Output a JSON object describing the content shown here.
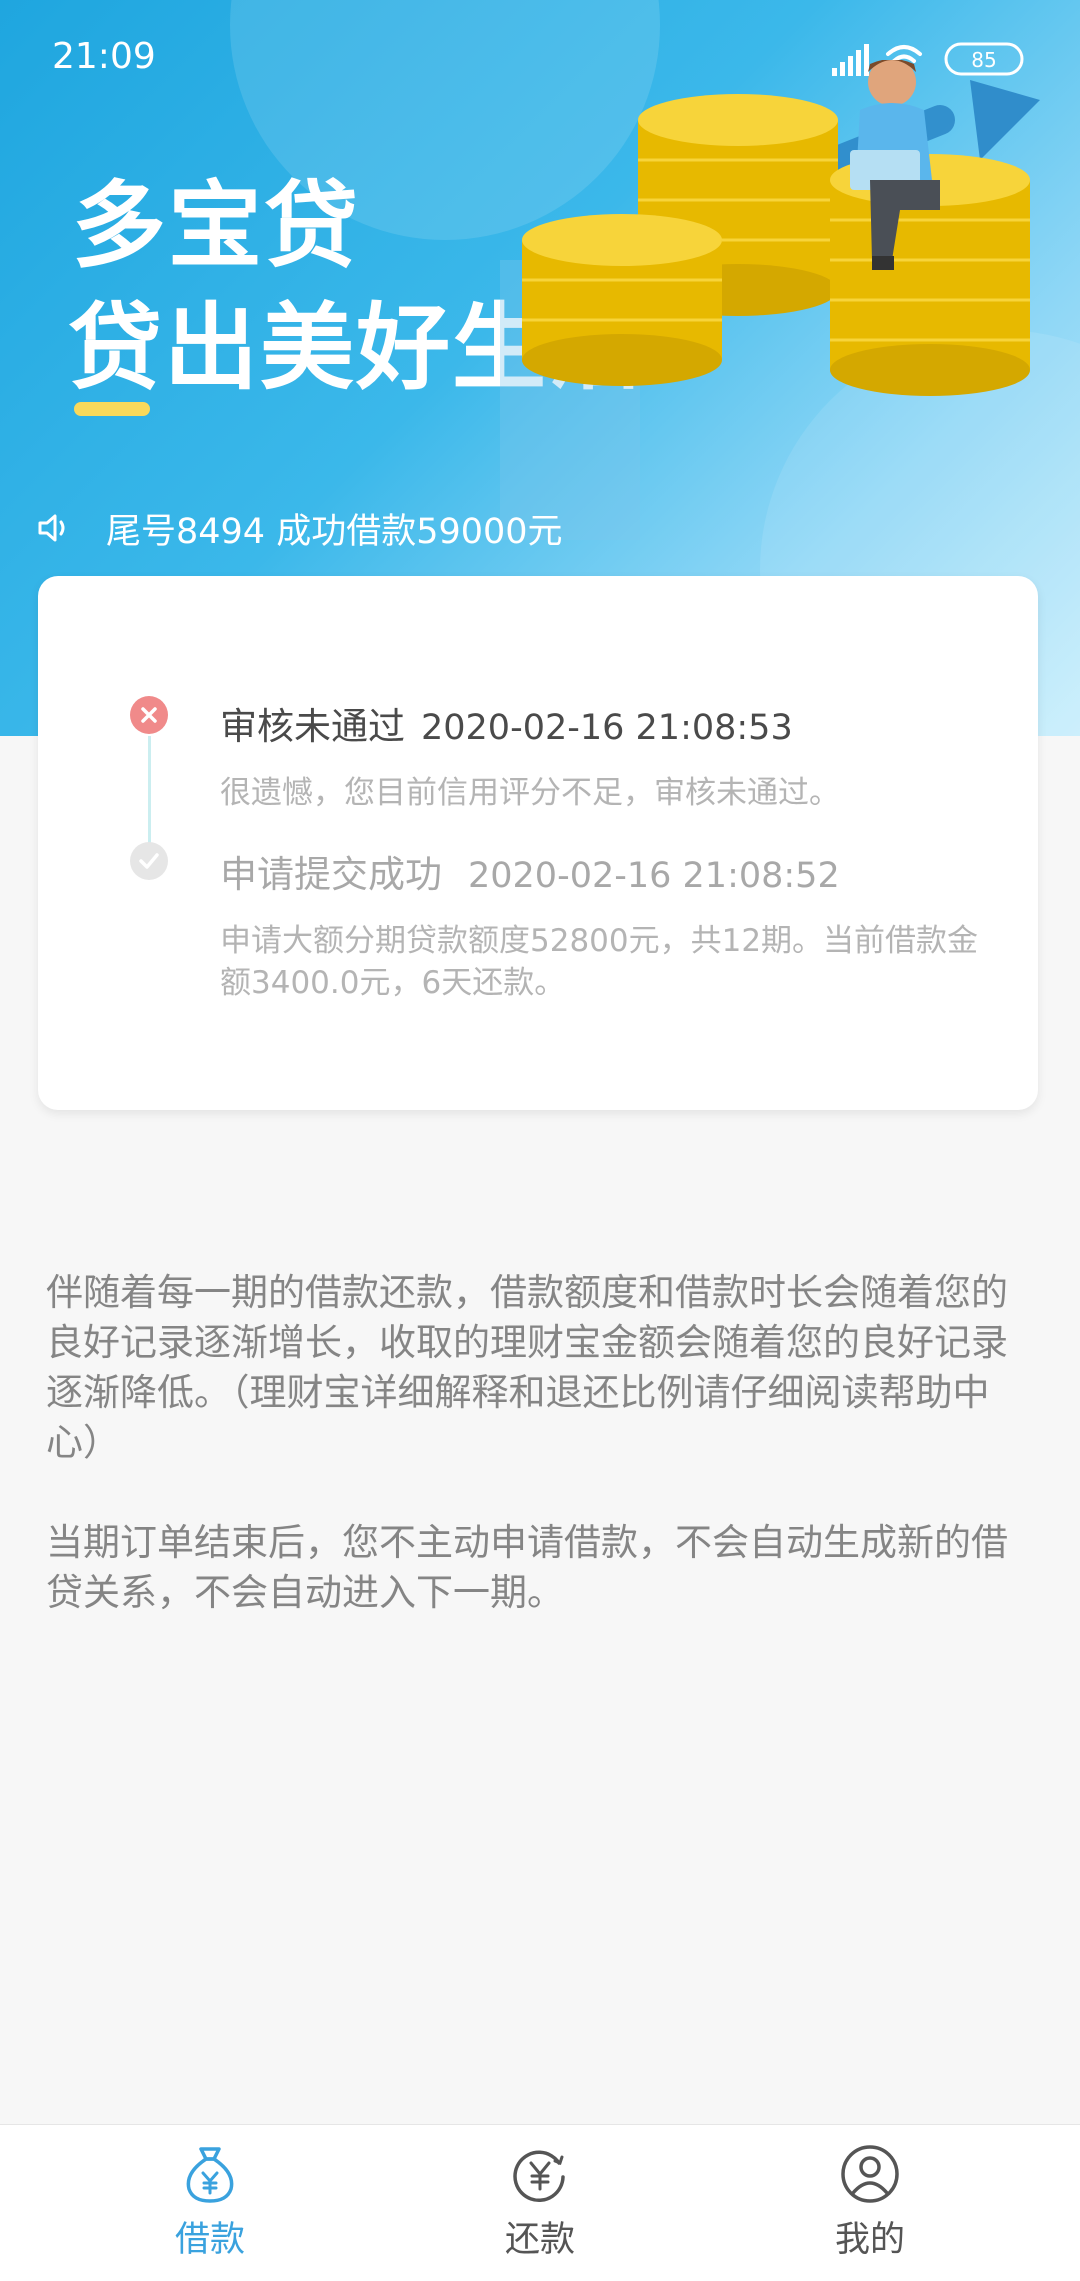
{
  "status_bar": {
    "time": "21:09",
    "battery": "85"
  },
  "banner": {
    "brand": "多宝贷",
    "slogan": "贷出美好生活",
    "notice": "尾号8494 成功借款59000元"
  },
  "timeline": [
    {
      "title": "审核未通过",
      "time": "2020-02-16 21:08:53",
      "desc": "很遗憾，您目前信用评分不足，审核未通过。",
      "status": "failed"
    },
    {
      "title": "申请提交成功",
      "time": "2020-02-16 21:08:52",
      "desc": "申请大额分期贷款额度52800元，共12期。当前借款金额3400.0元，6天还款。",
      "status": "done"
    }
  ],
  "info": {
    "p1": "伴随着每一期的借款还款，借款额度和借款时长会随着您的良好记录逐渐增长，收取的理财宝金额会随着您的良好记录逐渐降低。（理财宝详细解释和退还比例请仔细阅读帮助中心）",
    "p2": "当期订单结束后，您不主动申请借款，不会自动生成新的借贷关系，不会自动进入下一期。"
  },
  "tabs": [
    {
      "label": "借款",
      "icon": "money-bag-icon",
      "active": true
    },
    {
      "label": "还款",
      "icon": "yen-coin-icon",
      "active": false
    },
    {
      "label": "我的",
      "icon": "user-icon",
      "active": false
    }
  ],
  "colors": {
    "accent": "#3aa2de",
    "fail": "#f08a8a",
    "highlight": "#f9d95b"
  }
}
